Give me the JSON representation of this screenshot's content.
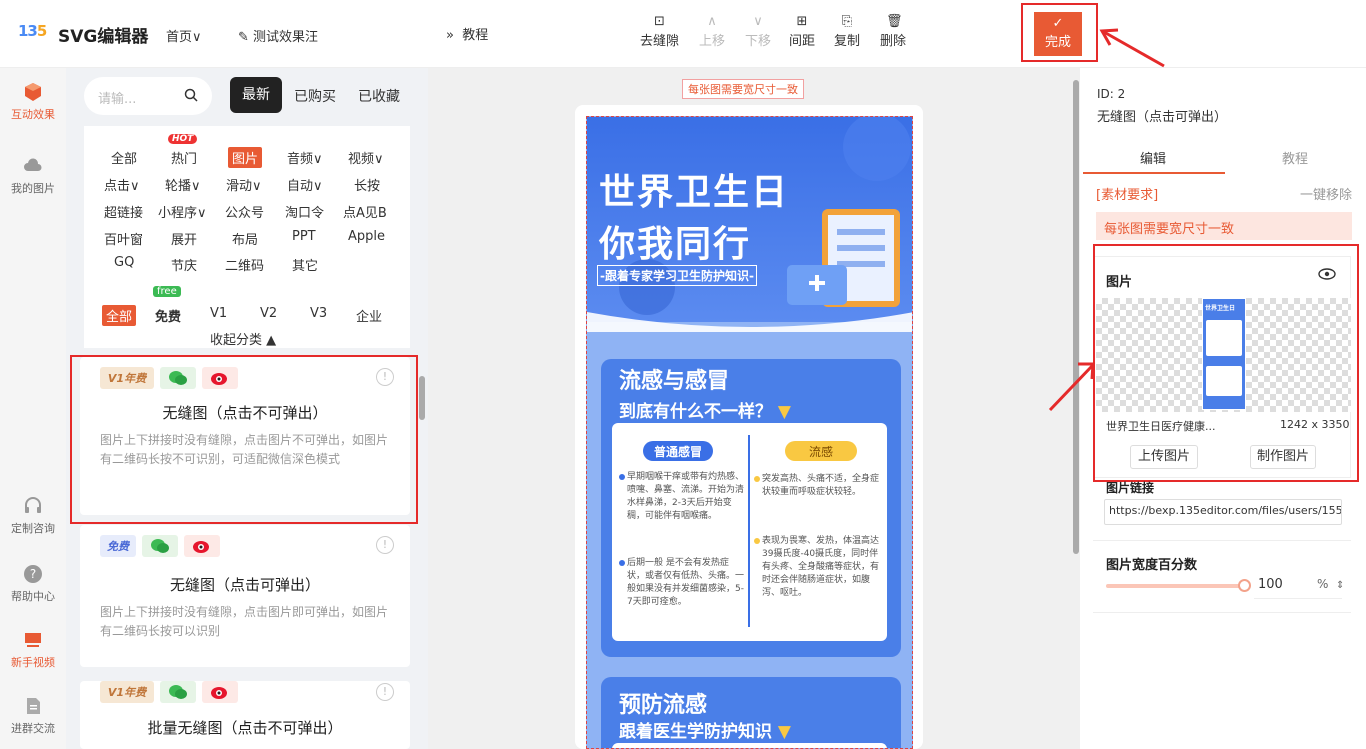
{
  "header": {
    "app_name": "SVG编辑器",
    "home_label": "首页",
    "test_label": "测试效果汪"
  },
  "leftnav": {
    "items": [
      {
        "label": "互动效果"
      },
      {
        "label": "我的图片"
      },
      {
        "label": "定制咨询"
      },
      {
        "label": "帮助中心"
      },
      {
        "label": "新手视频"
      },
      {
        "label": "进群交流"
      }
    ]
  },
  "search": {
    "placeholder": "请输..."
  },
  "filter_tabs": {
    "newest": "最新",
    "bought": "已购买",
    "favorites": "已收藏"
  },
  "categories": {
    "row1": [
      "全部",
      "热门",
      "图片",
      "音频∨",
      "视频∨"
    ],
    "row2": [
      "点击∨",
      "轮播∨",
      "滑动∨",
      "自动∨",
      "长按"
    ],
    "row3": [
      "超链接",
      "小程序∨",
      "公众号",
      "淘口令",
      "点A见B"
    ],
    "row4": [
      "百叶窗",
      "展开",
      "布局",
      "PPT",
      "Apple"
    ],
    "row5": [
      "GQ",
      "节庆",
      "二维码",
      "其它"
    ],
    "hot_badge": "HOT",
    "tiers": [
      "全部",
      "免费",
      "V1",
      "V2",
      "V3",
      "企业"
    ],
    "free_badge": "free",
    "collapse": "收起分类 ▲"
  },
  "cards": [
    {
      "badge": "V1年费",
      "title": "无缝图（点击不可弹出）",
      "desc": "图片上下拼接时没有缝隙，点击图片不可弹出，如图片有二维码长按不可识别，可适配微信深色模式"
    },
    {
      "badge": "免费",
      "title": "无缝图（点击可弹出）",
      "desc": "图片上下拼接时没有缝隙，点击图片即可弹出，如图片有二维码长按可以识别"
    },
    {
      "badge": "V1年费",
      "title": "批量无缝图（点击不可弹出）",
      "desc": ""
    }
  ],
  "toolbar": {
    "tutorial": "教程",
    "tools": [
      "去缝隙",
      "上移",
      "下移",
      "间距",
      "复制",
      "删除"
    ],
    "done": "完成"
  },
  "canvas": {
    "warning": "每张图需要宽尺寸一致",
    "poster": {
      "title1": "世界卫生日",
      "title2": "你我同行",
      "subtitle": "-跟着专家学习卫生防护知识-",
      "section1_title": "流感与感冒",
      "section1_sub": "到底有什么不一样？",
      "col_a": "普通感冒",
      "col_b": "流感",
      "a1": "早期咽喉干痒或带有灼热感、喷嚏、鼻塞、流涕。开始为清水样鼻涕，2-3天后开始变稠，可能伴有咽喉痛。",
      "a2": "后期一般 是不会有发热症状，或者仅有低热、头痛。一般如果没有并发细菌感染，5-7天即可痊愈。",
      "b1": "突发高热、头痛不适，全身症状较重而呼吸症状较轻。",
      "b2": "表现为畏寒、发热，体温高达39摄氏度-40摄氏度，同时伴有头疼、全身酸痛等症状，有时还会伴随肠道症状，如腹泻、呕吐。",
      "section2_title": "预防流感",
      "section2_sub": "跟着医生学防护知识"
    }
  },
  "right": {
    "id": "ID: 2",
    "name": "无缝图（点击可弹出）",
    "tab_edit": "编辑",
    "tab_tutorial": "教程",
    "material": "[素材要求]",
    "remove_all": "一键移除",
    "warning": "每张图需要宽尺寸一致",
    "image_label": "图片",
    "thumb_title": "世界卫生日",
    "image_name": "世界卫生日医疗健康...",
    "image_size": "1242 x 3350",
    "upload": "上传图片",
    "make": "制作图片",
    "link_label": "图片链接",
    "link_value": "https://bexp.135editor.com/files/users/1552/15",
    "width_label": "图片宽度百分数",
    "width_value": "100",
    "width_unit": "%"
  }
}
